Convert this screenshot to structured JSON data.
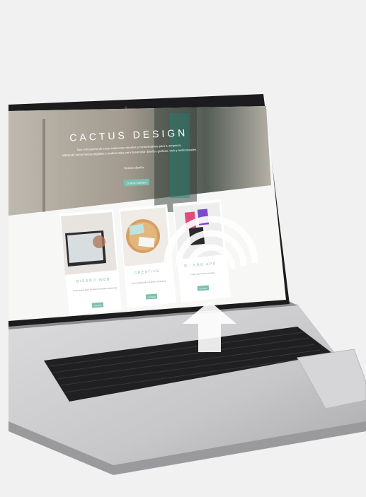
{
  "hero": {
    "brand_title": "CACTUS DESIGN",
    "tagline_line1": "Nos entusiasma de crear soluciones visuales y comunicativas para tu empresa,",
    "tagline_line2": "utilizando herramientas digitales y tradicionales para desarrollar diseños gráficos, web y audiovisuales.",
    "tagline_line3": "Somos diseño.",
    "cta_label": "CONTACTARNOS"
  },
  "cards": [
    {
      "title": "DISEÑO WEB",
      "description": "Lorem ipsum dolor sit amet consectetur adipiscing",
      "button_label": "VER MÁS"
    },
    {
      "title": "CREATIVE",
      "description": "Lorem ipsum dolor sit amet consectetur",
      "button_label": "VER MÁS"
    },
    {
      "title": "DISEÑO APP",
      "description": "Lorem ipsum dolor sit amet",
      "button_label": "VER MÁS"
    }
  ],
  "colors": {
    "background": "#f1f1f1",
    "accent": "#7dbfae",
    "laptop_bezel": "#1c1c1e",
    "laptop_body": "#c9c9cb"
  },
  "overlay": {
    "icon": "tap-gesture-icon"
  }
}
